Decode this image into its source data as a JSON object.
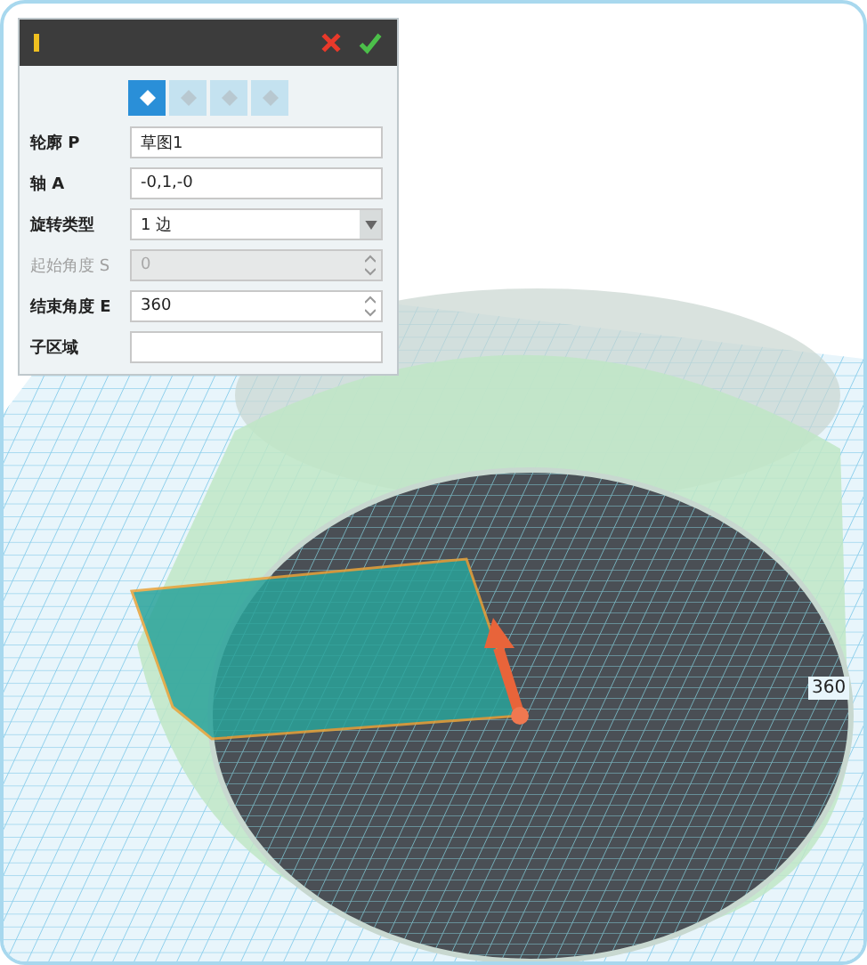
{
  "panel": {
    "modes": [
      {
        "selected": true
      },
      {
        "selected": false
      },
      {
        "selected": false
      },
      {
        "selected": false
      }
    ],
    "fields": [
      {
        "label": "轮廓 P",
        "kind": "text",
        "value": "草图1",
        "disabled": false
      },
      {
        "label": "轴 A",
        "kind": "text",
        "value": "-0,1,-0",
        "disabled": false
      },
      {
        "label": "旋转类型",
        "kind": "dropdown",
        "value": "1 边",
        "disabled": false
      },
      {
        "label": "起始角度 S",
        "kind": "spinner",
        "value": "0",
        "disabled": true
      },
      {
        "label": "结束角度 E",
        "kind": "spinner",
        "value": "360",
        "disabled": false
      },
      {
        "label": "子区域",
        "kind": "text",
        "disabled": false
      }
    ]
  },
  "viewport": {
    "angle_label": "360"
  }
}
